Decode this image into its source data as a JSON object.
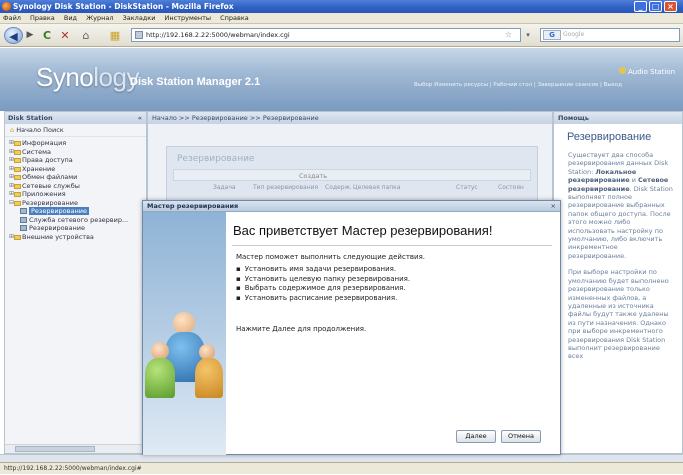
{
  "browser": {
    "title": "Synology Disk Station - DiskStation - Mozilla Firefox",
    "menu": [
      "Файл",
      "Правка",
      "Вид",
      "Журнал",
      "Закладки",
      "Инструменты",
      "Справка"
    ],
    "url": "http://192.168.2.22:5000/webman/index.cgi",
    "search_engine": "G",
    "search_placeholder": "Google",
    "status": "http://192.168.2.22:5000/webman/index.cgi#"
  },
  "dsm": {
    "logo_main": "Syno",
    "logo_rest": "logy",
    "product": "Disk Station Manager 2.1",
    "user": "Audio Station",
    "user_links": "Выбор Изменить ресурсы | Рабочий стол | Завершение сеансов | Выход"
  },
  "sidebar": {
    "header": "Disk Station",
    "tools": "Начало   Поиск",
    "tree": [
      {
        "label": "Информация",
        "level": 0
      },
      {
        "label": "Система",
        "level": 0
      },
      {
        "label": "Права доступа",
        "level": 0
      },
      {
        "label": "Хранение",
        "level": 0
      },
      {
        "label": "Обмен файлами",
        "level": 0
      },
      {
        "label": "Сетевые службы",
        "level": 0
      },
      {
        "label": "Приложения",
        "level": 0
      },
      {
        "label": "Резервирование",
        "level": 0
      },
      {
        "label": "Резервирование",
        "level": 1,
        "selected": true
      },
      {
        "label": "Служба сетевого резервир...",
        "level": 1
      },
      {
        "label": "Резервирование",
        "level": 1
      },
      {
        "label": "Внешние устройства",
        "level": 0
      }
    ]
  },
  "center": {
    "breadcrumb": "Начало >> Резервирование >> Резервирование",
    "panel_title": "Резервирование",
    "toolbar_create": "Создать",
    "columns": [
      "Задача",
      "Тип резервирования",
      "Содерж.",
      "Целевая папка",
      "Статус",
      "Состоян"
    ]
  },
  "wizard": {
    "header": "Мастер резервирования",
    "title": "Вас приветствует Мастер резервирования!",
    "intro": "Мастер поможет выполнить следующие действия.",
    "steps": [
      "Установить имя задачи резервирования.",
      "Установить целевую папку резервирования.",
      "Выбрать содержимое для резервирования.",
      "Установить расписание резервирования."
    ],
    "next_hint": "Нажмите Далее для продолжения.",
    "next_label": "Далее",
    "cancel_label": "Отмена"
  },
  "help": {
    "header": "Помощь",
    "title": "Резервирование",
    "p1_a": "Существует два способа резервирования данных Disk Station: ",
    "p1_b": "Локальное резервирование",
    "p1_c": " и ",
    "p1_d": "Сетевое резервирование",
    "p1_e": ". Disk Station выполняет полное резервирование выбранных папок общего доступа. После этого можно либо использовать настройку по умолчанию, либо включить инкрементное резервирование.",
    "p2": "При выборе настройки по умолчанию будет выполнено резервирование только измененных файлов, а удаленные из источника файлы будут также удалены из пути назначения. Однако при выборе инкрементного резервирования Disk Station выполнит резервирование всех"
  }
}
